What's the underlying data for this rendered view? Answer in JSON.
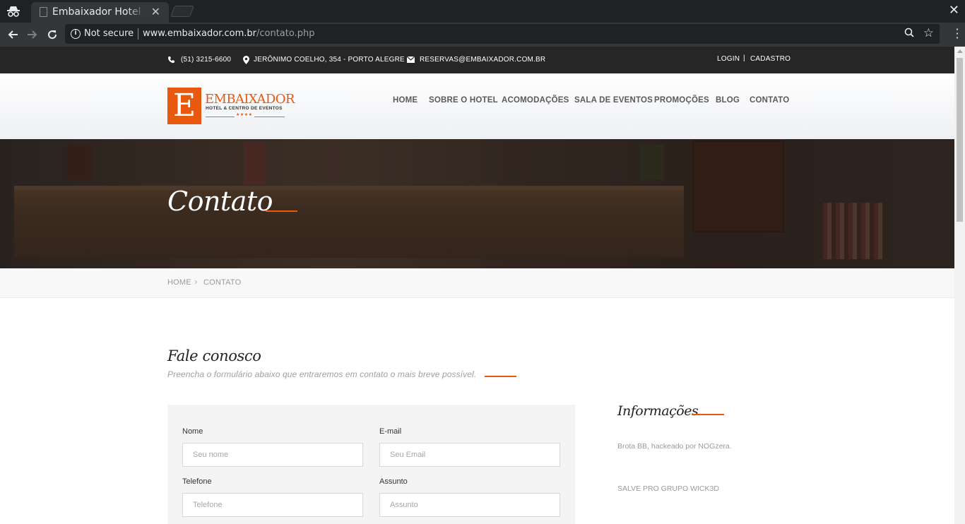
{
  "browser": {
    "tab_title": "Embaixador Hotel e Centro de Eventos",
    "security_label": "Not secure",
    "url_host": "www.embaixador.com.br",
    "url_path": "/contato.php"
  },
  "topbar": {
    "phone": "(51) 3215-6600",
    "address": "JERÔNIMO COELHO, 354 - PORTO ALEGRE",
    "email": "RESERVAS@EMBAIXADOR.COM.BR",
    "login": "LOGIN",
    "separator": "|",
    "register": "CADASTRO"
  },
  "logo": {
    "letter": "E",
    "name": "EMBAIXADOR",
    "subtitle": "HOTEL & CENTRO DE EVENTOS",
    "stars": "★★★★"
  },
  "nav": {
    "items": [
      "HOME",
      "SOBRE O HOTEL",
      "ACOMODAÇÕES",
      "SALA DE EVENTOS",
      "PROMOÇÕES",
      "BLOG",
      "CONTATO"
    ]
  },
  "hero": {
    "title": "Contato"
  },
  "breadcrumb": {
    "home": "HOME",
    "separator": "›",
    "current": "CONTATO"
  },
  "contact": {
    "title": "Fale conosco",
    "subtitle": "Preencha o formulário abaixo que entraremos em contato o mais breve possível."
  },
  "form": {
    "name_label": "Nome",
    "name_placeholder": "Seu nome",
    "email_label": "E-mail",
    "email_placeholder": "Seu Email",
    "phone_label": "Telefone",
    "phone_placeholder": "Telefone",
    "subject_label": "Assunto",
    "subject_placeholder": "Assunto"
  },
  "info": {
    "title": "Informações",
    "line1": "Brota BB, hackeado por NOGzera.",
    "line2": "SALVE PRO GRUPO WICK3D"
  },
  "colors": {
    "accent": "#e8580f",
    "topbar_bg": "#262626",
    "chrome_bg": "#202124"
  }
}
